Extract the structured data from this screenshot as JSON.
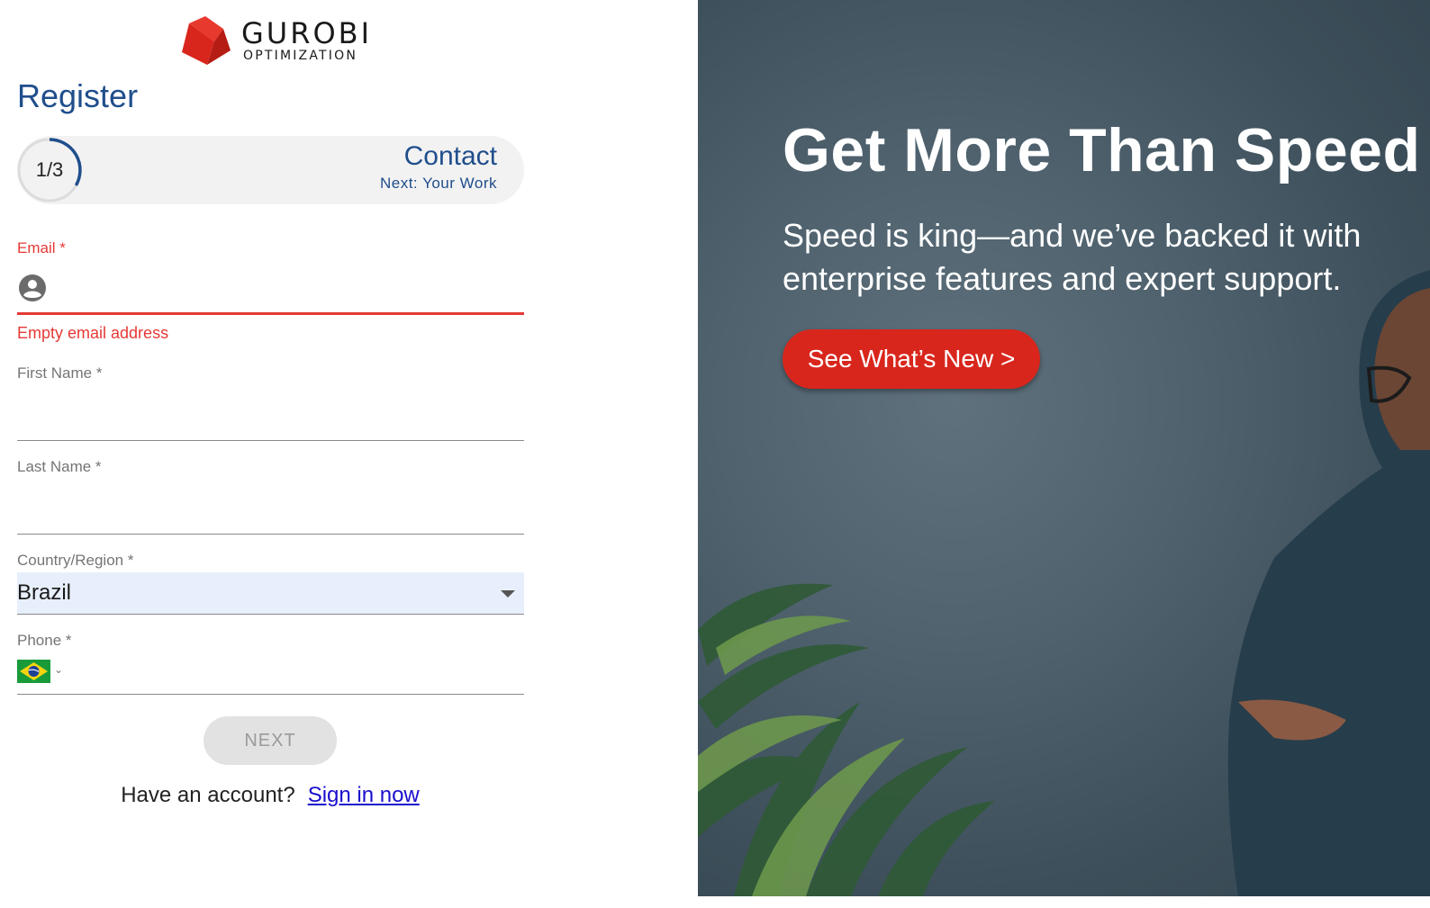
{
  "brand": {
    "name": "GUROBI",
    "tagline": "OPTIMIZATION",
    "logo_color": "#d9261c"
  },
  "register": {
    "title": "Register",
    "stepper": {
      "count": "1/3",
      "progress": 0.33,
      "current": "Contact",
      "next": "Next: Your Work"
    },
    "email": {
      "label": "Email *",
      "value": "",
      "error": "Empty email address"
    },
    "first_name": {
      "label": "First Name *",
      "value": ""
    },
    "last_name": {
      "label": "Last Name *",
      "value": ""
    },
    "country": {
      "label": "Country/Region *",
      "value": "Brazil"
    },
    "phone": {
      "label": "Phone *",
      "value": "",
      "flag": "brazil-flag-icon"
    },
    "next_label": "NEXT",
    "account_prompt": "Have an account?",
    "signin_label": "Sign in now"
  },
  "hero": {
    "title": "Get More Than Speed",
    "subtitle": "Speed is king—and we’ve backed it with enterprise features and expert support.",
    "cta_label": "See What’s New >"
  },
  "colors": {
    "accent_blue": "#1f4e8c",
    "error_red": "#e53935",
    "cta_red": "#d9261c",
    "link": "#1a0dcc"
  }
}
